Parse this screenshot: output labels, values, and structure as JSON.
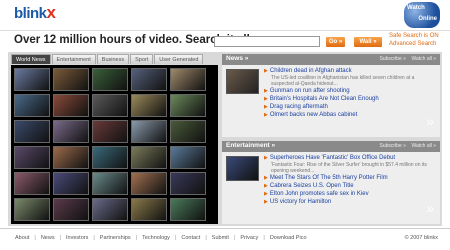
{
  "logo": {
    "part1": "blink",
    "part2": "x"
  },
  "badge": {
    "line1": "Watch",
    "line2": "Online"
  },
  "tagline": "Over 12 million hours of video. Search it all.",
  "search": {
    "value": "",
    "go_label": "Go »",
    "wall_label": "Wall »"
  },
  "safe_search": "Safe Search is ON",
  "advanced_search": "Advanced Search",
  "tabs": [
    "World News",
    "Entertainment",
    "Business",
    "Sport",
    "User Generated"
  ],
  "thumb_colors": [
    "#6a7aa0",
    "#7a5a3a",
    "#3a5f3a",
    "#55607a",
    "#a08a6a",
    "#4a6a8a",
    "#8a4a3a",
    "#5a5a5a",
    "#9a8a5a",
    "#6a8a5a",
    "#3a4a6a",
    "#7a6a8a",
    "#6a3a3a",
    "#8a9aaa",
    "#4a5a3a",
    "#5a4a6a",
    "#9a6a4a",
    "#3a6a7a",
    "#7a7a5a",
    "#5a7a9a",
    "#8a5a6a",
    "#4a4a7a",
    "#6a8a8a",
    "#a07050",
    "#3a3a5a",
    "#7a8a6a",
    "#5a3a4a",
    "#6a6a8a",
    "#8a7a4a",
    "#4a7a5a"
  ],
  "news": {
    "title": "News »",
    "subscribe": "Subscribe »",
    "watch_all": "Watch all »",
    "thumb_color": "#6a5a4a",
    "items": [
      {
        "headline": "Children dead in Afghan attack",
        "sub": "The US-led coalition in Afghanistan has killed seven children at a suspected al-Qaeda hideout..."
      },
      {
        "headline": "Gunman on run after shooting",
        "sub": ""
      },
      {
        "headline": "Britain's Hospitals Are Not Clean Enough",
        "sub": ""
      },
      {
        "headline": "Drag racing aftermath",
        "sub": ""
      },
      {
        "headline": "Olmert backs new Abbas cabinet",
        "sub": ""
      }
    ]
  },
  "entertainment": {
    "title": "Entertainment »",
    "subscribe": "Subscribe »",
    "watch_all": "Watch all »",
    "thumb_color": "#3a4a7a",
    "items": [
      {
        "headline": "Superheroes Have 'Fantastic' Box Office Debut",
        "sub": "'Fantastic Four: Rise of the Silver Surfer' brought in $57.4 million on its opening weekend..."
      },
      {
        "headline": "Meet The Stars Of The 5th Harry Potter Film",
        "sub": ""
      },
      {
        "headline": "Cabrera Seizes U.S. Open Title",
        "sub": ""
      },
      {
        "headline": "Elton John promotes safe sex in Kiev",
        "sub": ""
      },
      {
        "headline": "US victory for Hamilton",
        "sub": ""
      }
    ]
  },
  "footer": {
    "links": [
      "About",
      "News",
      "Investors",
      "Partnerships",
      "Technology",
      "Contact",
      "Submit",
      "Privacy",
      "Download Pico"
    ],
    "copyright": "© 2007 blinkx"
  }
}
